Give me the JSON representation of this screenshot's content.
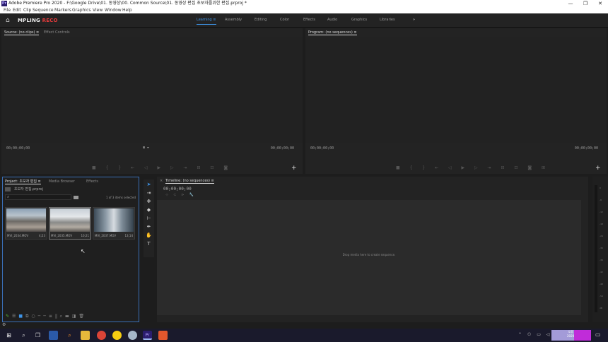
{
  "window": {
    "title": "Adobe Premiere Pro 2020 - F:\\Google Drive\\01. 동영상\\00. Common Source\\01. 동영상 편집 초보자를위한 편집.prproj *",
    "app_icon": "Pr",
    "controls": [
      "minimize-icon",
      "restore-icon",
      "close-icon"
    ]
  },
  "menu": [
    "File",
    "Edit",
    "Clip",
    "Sequence",
    "Markers",
    "Graphics",
    "View",
    "Window",
    "Help"
  ],
  "header": {
    "brand_main": "MPLING",
    "brand_rec": "RECO",
    "workspaces": [
      {
        "label": "Learning",
        "active": true
      },
      {
        "label": "Assembly",
        "active": false
      },
      {
        "label": "Editing",
        "active": false
      },
      {
        "label": "Color",
        "active": false
      },
      {
        "label": "Effects",
        "active": false
      },
      {
        "label": "Audio",
        "active": false
      },
      {
        "label": "Graphics",
        "active": false
      },
      {
        "label": "Libraries",
        "active": false
      }
    ],
    "more": "»"
  },
  "source": {
    "tabs": [
      "Source: (no clips) ≡",
      "Effect Controls"
    ],
    "tc_left": "00;00;00;00",
    "tc_right": "00;00;00;00"
  },
  "program": {
    "tab": "Program: (no sequences) ≡",
    "tc_left": "00;00;00;00",
    "tc_right": "00;00;00;00"
  },
  "project": {
    "tabs": [
      "Project: 초보자 편집 ≡",
      "Media Browser",
      "Effects"
    ],
    "bin": "초보자 편집.prproj",
    "search_placeholder": "",
    "selection_info": "1 of 3 items selected",
    "items": [
      {
        "name": "MVI_2034.MOV",
        "duration": "4;23"
      },
      {
        "name": "MVI_2035.MOV",
        "duration": "10;21"
      },
      {
        "name": "MVI_2037.MOV",
        "duration": "13;14"
      }
    ]
  },
  "timeline": {
    "tab": "Timeline: (no sequences) ≡",
    "timecode": "00;00;00;00",
    "empty_message": "Drop media here to create sequence."
  },
  "meters": {
    "ticks": [
      "0",
      "-6",
      "-12",
      "-18",
      "-24",
      "-30",
      "-36",
      "-42",
      "-48",
      "-54",
      "dB"
    ]
  },
  "taskbar": {
    "apps": [
      "windows-start-icon",
      "search-icon",
      "task-view-icon",
      "explorer-icon",
      "search-app-icon",
      "folder-icon",
      "chrome-icon",
      "yellow-app-icon",
      "blue-app-icon",
      "premiere-icon",
      "orange-app-icon"
    ],
    "clock_time": "오후",
    "clock_date": "2020"
  },
  "colors": {
    "accent": "#3e94e8",
    "rec": "#e53b3b",
    "panel": "#232323",
    "background": "#1d1d1d"
  }
}
